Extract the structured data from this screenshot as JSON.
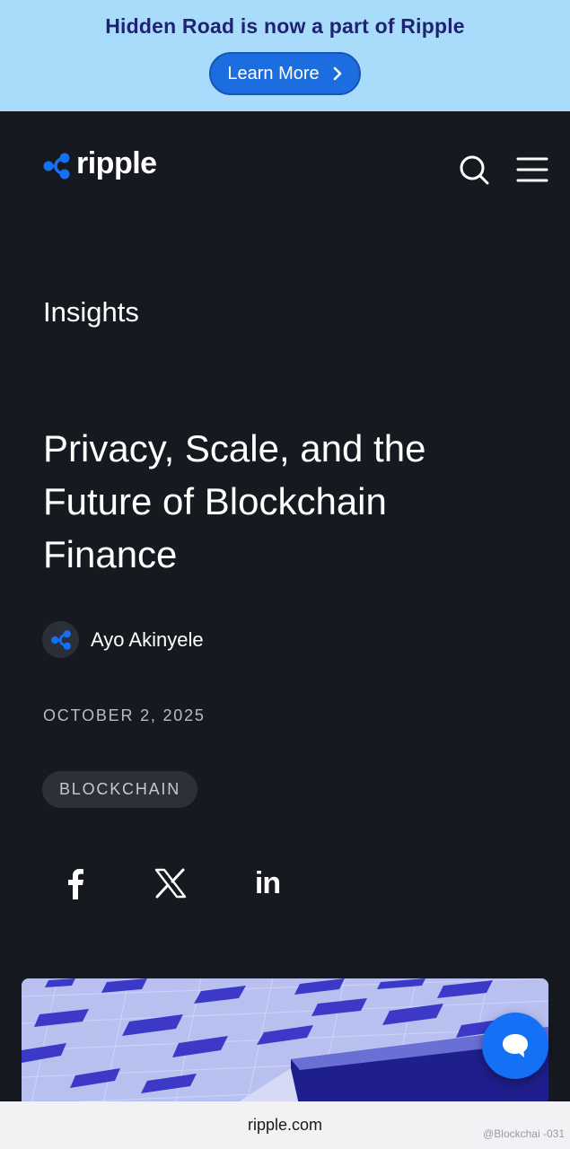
{
  "banner": {
    "title": "Hidden Road is now a part of Ripple",
    "button_label": "Learn More",
    "background": "#a8dcfa",
    "button_color": "#1c6ee0"
  },
  "header": {
    "logo_text": "ripple",
    "logo_icon": "ripple-logo-icon",
    "search_icon": "search-icon",
    "menu_icon": "hamburger-menu-icon"
  },
  "article": {
    "eyebrow": "Insights",
    "title": "Privacy, Scale, and the Future of Blockchain Finance",
    "author": "Ayo Akinyele",
    "date": "OCTOBER 2, 2025",
    "tag": "BLOCKCHAIN"
  },
  "share": {
    "icons": [
      "facebook-icon",
      "x-icon",
      "linkedin-icon"
    ],
    "linkedin_glyph": "in"
  },
  "chat": {
    "icon": "chat-bubble-icon",
    "color": "#1470f5"
  },
  "browser": {
    "url": "ripple.com"
  },
  "watermark": "@Blockchai -031",
  "colors": {
    "page_background": "#161920",
    "accent": "#1470f5"
  }
}
